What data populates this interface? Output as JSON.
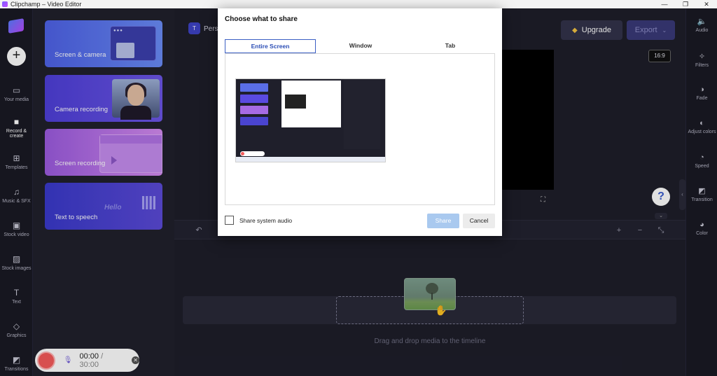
{
  "window": {
    "title": "Clipchamp – Video Editor",
    "controls": [
      "—",
      "❐",
      "✕"
    ]
  },
  "left_nav": {
    "items": [
      {
        "label": "Your media",
        "icon": "folder-icon"
      },
      {
        "label": "Record &\ncreate",
        "icon": "camera-icon"
      },
      {
        "label": "Templates",
        "icon": "templates-icon"
      },
      {
        "label": "Music & SFX",
        "icon": "music-icon"
      },
      {
        "label": "Stock video",
        "icon": "film-icon"
      },
      {
        "label": "Stock images",
        "icon": "image-icon"
      },
      {
        "label": "Text",
        "icon": "text-icon"
      },
      {
        "label": "Graphics",
        "icon": "shapes-icon"
      },
      {
        "label": "Transitions",
        "icon": "transition-icon"
      }
    ],
    "active_index": 1
  },
  "record_panel": {
    "cards": [
      {
        "label": "Screen & camera"
      },
      {
        "label": "Camera recording"
      },
      {
        "label": "Screen recording"
      },
      {
        "label": "Text to speech",
        "decoration": "Hello"
      }
    ]
  },
  "recorder": {
    "elapsed": "00:00",
    "total": "/ 30:00"
  },
  "editor": {
    "project_initial": "T",
    "project_name": "Pers",
    "upgrade_label": "Upgrade",
    "export_label": "Export",
    "aspect_ratio": "16:9",
    "help_label": "?",
    "drop_hint": "Drag and drop media to the timeline"
  },
  "right_nav": {
    "items": [
      {
        "label": "Audio",
        "icon": "speaker-icon"
      },
      {
        "label": "Filters",
        "icon": "wand-icon"
      },
      {
        "label": "Fade",
        "icon": "fade-icon"
      },
      {
        "label": "Adjust colors",
        "icon": "contrast-icon"
      },
      {
        "label": "Speed",
        "icon": "speedometer-icon"
      },
      {
        "label": "Transition",
        "icon": "transition-icon"
      },
      {
        "label": "Color",
        "icon": "palette-icon"
      }
    ]
  },
  "share_dialog": {
    "title": "Choose what to share",
    "tabs": [
      "Entire Screen",
      "Window",
      "Tab"
    ],
    "active_tab": 0,
    "audio_label": "Share system audio",
    "audio_checked": false,
    "share_label": "Share",
    "cancel_label": "Cancel"
  }
}
